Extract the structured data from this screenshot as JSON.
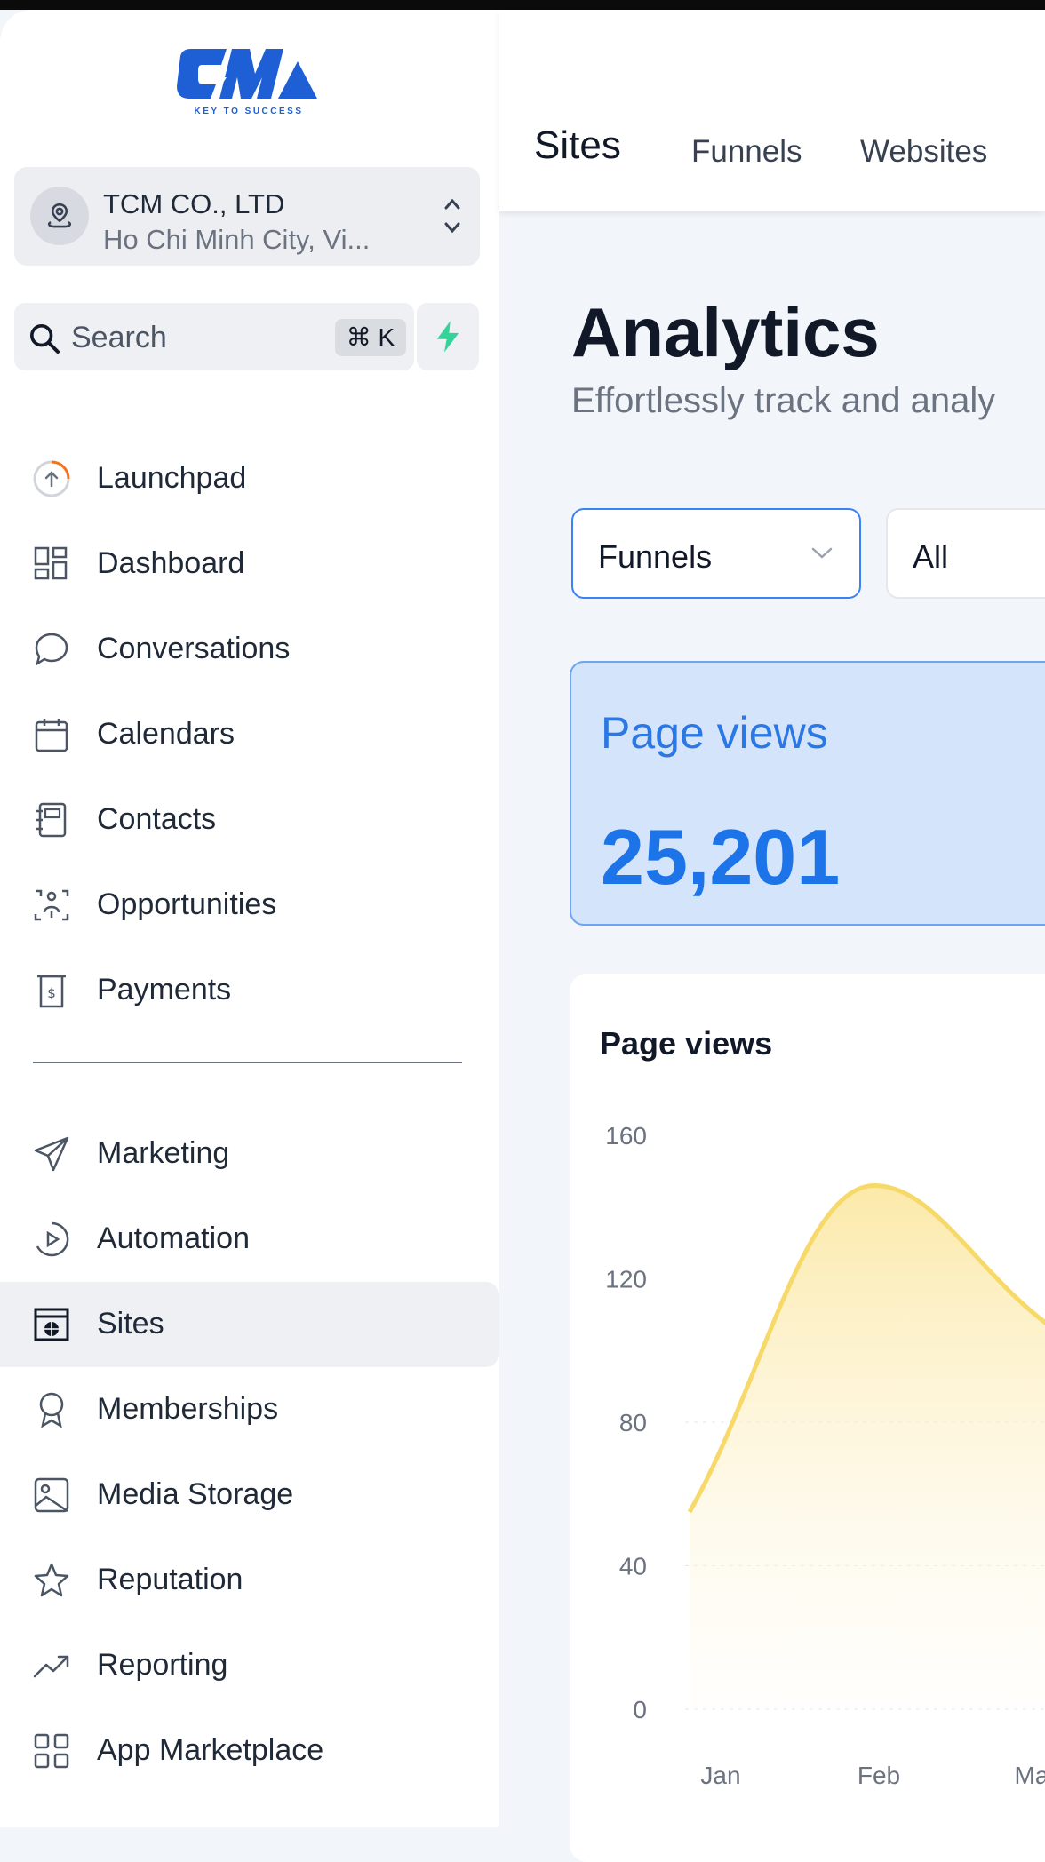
{
  "brand": {
    "logo_text": "TCM",
    "tagline": "KEY TO SUCCESS"
  },
  "account": {
    "name": "TCM CO., LTD",
    "location": "Ho Chi Minh City, Vi..."
  },
  "search": {
    "label": "Search",
    "shortcut": "⌘ K"
  },
  "sidebar": {
    "items": [
      {
        "label": "Launchpad",
        "icon": "launchpad-icon"
      },
      {
        "label": "Dashboard",
        "icon": "dashboard-grid-icon"
      },
      {
        "label": "Conversations",
        "icon": "chat-bubble-icon"
      },
      {
        "label": "Calendars",
        "icon": "calendar-icon"
      },
      {
        "label": "Contacts",
        "icon": "contact-book-icon"
      },
      {
        "label": "Opportunities",
        "icon": "opportunities-icon"
      },
      {
        "label": "Payments",
        "icon": "payments-icon"
      },
      {
        "label": "Marketing",
        "icon": "paper-plane-icon"
      },
      {
        "label": "Automation",
        "icon": "play-circle-icon"
      },
      {
        "label": "Sites",
        "icon": "sites-globe-icon",
        "active": true
      },
      {
        "label": "Memberships",
        "icon": "award-badge-icon"
      },
      {
        "label": "Media Storage",
        "icon": "image-icon"
      },
      {
        "label": "Reputation",
        "icon": "star-icon"
      },
      {
        "label": "Reporting",
        "icon": "trend-up-icon"
      },
      {
        "label": "App Marketplace",
        "icon": "apps-grid-icon"
      }
    ]
  },
  "tabs": {
    "sites": "Sites",
    "funnels": "Funnels",
    "websites": "Websites"
  },
  "page": {
    "title": "Analytics",
    "subtitle": "Effortlessly track and analy"
  },
  "filters": {
    "type_value": "Funnels",
    "scope_value": "All"
  },
  "stat": {
    "label": "Page views",
    "value": "25,201"
  },
  "colors": {
    "accent": "#3b82f6",
    "stat_bg": "#d4e4fb",
    "chart_line": "#f7d96a",
    "bolt": "#34d399"
  },
  "chart_data": {
    "type": "area",
    "title": "Page views",
    "x": [
      "Jan",
      "Feb",
      "Ma"
    ],
    "series": [
      {
        "values": [
          55,
          146,
          105
        ]
      }
    ],
    "ylim": [
      0,
      160
    ],
    "yticks": [
      0,
      40,
      80,
      120,
      160
    ],
    "grid": true
  }
}
